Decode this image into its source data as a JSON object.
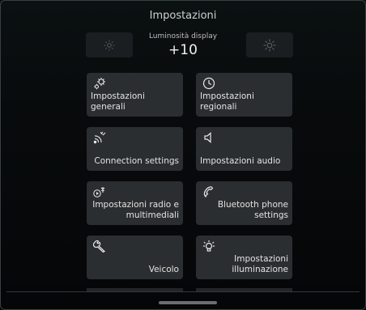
{
  "header": {
    "title": "Impostazioni"
  },
  "brightness": {
    "label": "Luminosità display",
    "value": "+10",
    "decrease_icon": "sun-dim-icon",
    "increase_icon": "sun-bright-icon"
  },
  "tiles": [
    {
      "label": "Impostazioni generali",
      "icon": "gears-icon"
    },
    {
      "label": "Impostazioni regionali",
      "icon": "clock-icon"
    },
    {
      "label": "Connection settings",
      "icon": "wireless-icon"
    },
    {
      "label": "Impostazioni audio",
      "icon": "speaker-icon"
    },
    {
      "label": "Impostazioni radio e multimediali",
      "icon": "radio-media-icon"
    },
    {
      "label": "Bluetooth phone settings",
      "icon": "phone-icon"
    },
    {
      "label": "Veicolo",
      "icon": "wrench-icon"
    },
    {
      "label": "Impostazioni illuminazione",
      "icon": "bulb-icon"
    }
  ],
  "colors": {
    "tile_bg": "#2b2e30",
    "text": "#e3e3e3",
    "background": "#080b0c"
  }
}
